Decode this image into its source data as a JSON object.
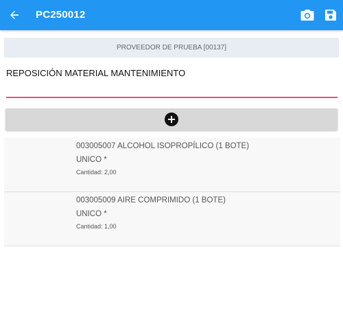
{
  "header": {
    "title": "PC250012",
    "back_icon": "arrow-back-icon",
    "camera_icon": "camera-icon",
    "save_icon": "save-icon",
    "background_color": "#2196f3"
  },
  "supplier": {
    "label": "PROVEEDOR DE PRUEBA [00137]"
  },
  "description": {
    "value": "REPOSICIÓN MATERIAL MANTENIMIENTO",
    "accent_color": "#e84d84"
  },
  "add_bar": {
    "icon": "add-circle-icon"
  },
  "items": [
    {
      "name": "003005007 ALCOHOL ISOPROPÍLICO (1 BOTE)",
      "variant": "UNICO *",
      "quantity": "Cantidad: 2,00"
    },
    {
      "name": "003005009 AIRE COMPRIMIDO (1 BOTE)",
      "variant": "UNICO *",
      "quantity": "Cantidad: 1,00"
    }
  ]
}
